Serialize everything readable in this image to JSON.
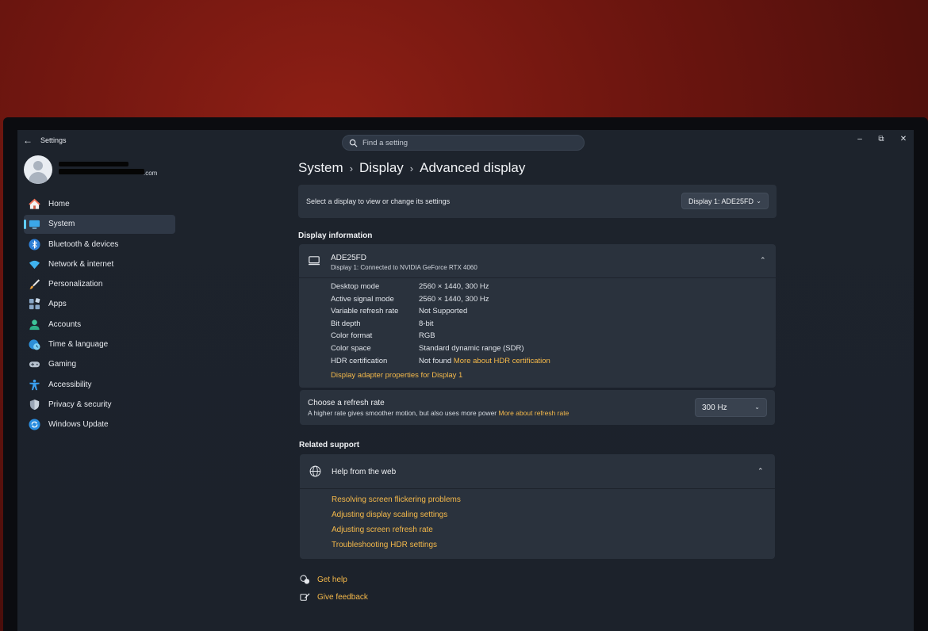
{
  "window": {
    "app_title": "Settings",
    "search_placeholder": "Find a setting",
    "controls": [
      "minimize-icon",
      "restore-icon",
      "close-icon"
    ]
  },
  "profile": {
    "email_visible_suffix": ".com"
  },
  "sidebar": {
    "items": [
      {
        "label": "Home",
        "icon": "home-icon",
        "active": false
      },
      {
        "label": "System",
        "icon": "system-icon",
        "active": true
      },
      {
        "label": "Bluetooth & devices",
        "icon": "bluetooth-icon",
        "active": false
      },
      {
        "label": "Network & internet",
        "icon": "wifi-icon",
        "active": false
      },
      {
        "label": "Personalization",
        "icon": "brush-icon",
        "active": false
      },
      {
        "label": "Apps",
        "icon": "apps-icon",
        "active": false
      },
      {
        "label": "Accounts",
        "icon": "account-icon",
        "active": false
      },
      {
        "label": "Time & language",
        "icon": "globe-clock-icon",
        "active": false
      },
      {
        "label": "Gaming",
        "icon": "gamepad-icon",
        "active": false
      },
      {
        "label": "Accessibility",
        "icon": "accessibility-icon",
        "active": false
      },
      {
        "label": "Privacy & security",
        "icon": "shield-icon",
        "active": false
      },
      {
        "label": "Windows Update",
        "icon": "update-icon",
        "active": false
      }
    ]
  },
  "breadcrumb": {
    "items": [
      "System",
      "Display",
      "Advanced display"
    ]
  },
  "select_display": {
    "label": "Select a display to view or change its settings",
    "value": "Display 1: ADE25FD"
  },
  "display_info": {
    "section_title": "Display information",
    "name": "ADE25FD",
    "subtitle": "Display 1: Connected to NVIDIA GeForce RTX 4060",
    "rows": [
      {
        "key": "Desktop mode",
        "value": "2560 × 1440, 300 Hz"
      },
      {
        "key": "Active signal mode",
        "value": "2560 × 1440, 300 Hz"
      },
      {
        "key": "Variable refresh rate",
        "value": "Not Supported"
      },
      {
        "key": "Bit depth",
        "value": "8-bit"
      },
      {
        "key": "Color format",
        "value": "RGB"
      },
      {
        "key": "Color space",
        "value": "Standard dynamic range (SDR)"
      },
      {
        "key": "HDR certification",
        "value": "Not found",
        "link": "More about HDR certification"
      }
    ],
    "adapter_link": "Display adapter properties for Display 1"
  },
  "refresh": {
    "title": "Choose a refresh rate",
    "subtitle": "A higher rate gives smoother motion, but also uses more power",
    "link": "More about refresh rate",
    "value": "300 Hz"
  },
  "related_support": {
    "section_title": "Related support",
    "help_title": "Help from the web",
    "links": [
      "Resolving screen flickering problems",
      "Adjusting display scaling settings",
      "Adjusting screen refresh rate",
      "Troubleshooting HDR settings"
    ]
  },
  "footer": {
    "get_help": "Get help",
    "give_feedback": "Give feedback"
  },
  "colors": {
    "accent_link": "#f5b94a",
    "active_indicator": "#60cdff",
    "card_bg": "#2a323d",
    "window_bg": "#1d232c"
  }
}
